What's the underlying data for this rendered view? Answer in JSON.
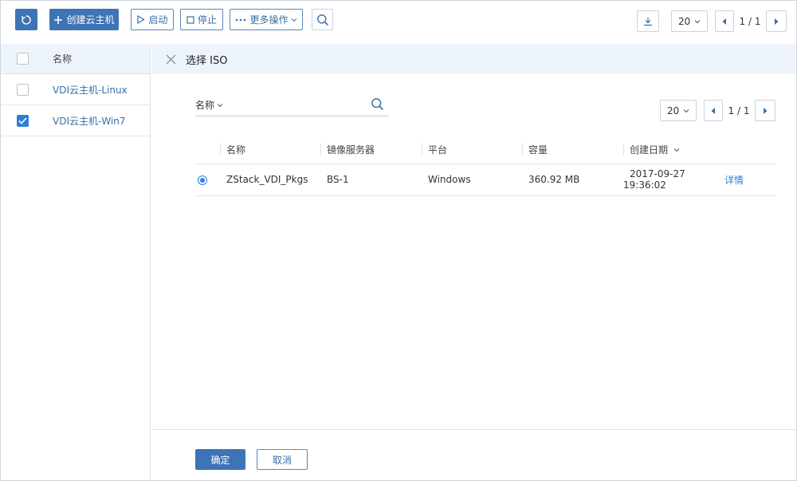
{
  "toolbar": {
    "create_label": "创建云主机",
    "start_label": "启动",
    "stop_label": "停止",
    "more_label": "更多操作",
    "page_size": "20",
    "page_indicator": "1 / 1"
  },
  "vm_list": {
    "header": "名称",
    "items": [
      {
        "name": "VDI云主机-Linux",
        "checked": false
      },
      {
        "name": "VDI云主机-Win7",
        "checked": true
      }
    ]
  },
  "dialog": {
    "title": "选择 ISO",
    "search_field": "名称",
    "search_placeholder": "",
    "page_size": "20",
    "page_indicator": "1 / 1",
    "columns": [
      "名称",
      "镜像服务器",
      "平台",
      "容量",
      "创建日期"
    ],
    "rows": [
      {
        "name": "ZStack_VDI_Pkgs",
        "server": "BS-1",
        "platform": "Windows",
        "size": "360.92 MB",
        "created": "2017-09-27 19:36:02",
        "action": "详情"
      }
    ],
    "ok_label": "确定",
    "cancel_label": "取消"
  },
  "colors": {
    "accent": "#3e73b5",
    "link": "#2f7fd8",
    "header_bg": "#eef4fb"
  }
}
